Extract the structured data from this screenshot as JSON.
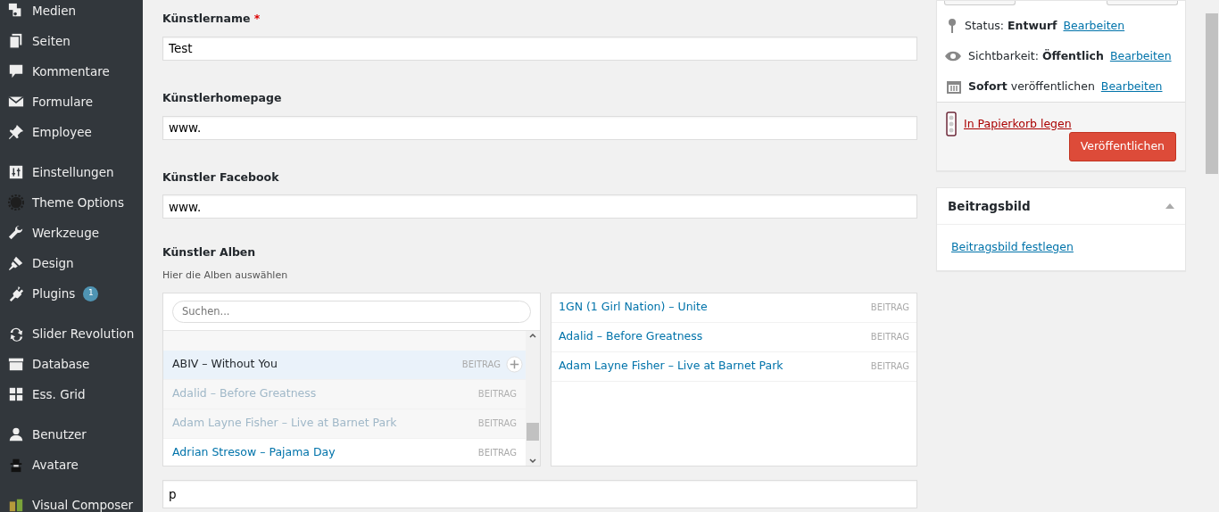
{
  "sidebar": {
    "groups": [
      [
        {
          "label": "Medien"
        },
        {
          "label": "Seiten"
        },
        {
          "label": "Kommentare"
        },
        {
          "label": "Formulare"
        },
        {
          "label": "Employee"
        }
      ],
      [
        {
          "label": "Einstellungen"
        },
        {
          "label": "Theme Options"
        },
        {
          "label": "Werkzeuge"
        },
        {
          "label": "Design"
        },
        {
          "label": "Plugins",
          "badge": "1"
        }
      ],
      [
        {
          "label": "Slider Revolution"
        },
        {
          "label": "Database"
        },
        {
          "label": "Ess. Grid"
        }
      ],
      [
        {
          "label": "Benutzer"
        },
        {
          "label": "Avatare"
        }
      ],
      [
        {
          "label": "Visual Composer"
        }
      ]
    ]
  },
  "fields": [
    {
      "label": "Künstlername",
      "required_mark": "*",
      "value": "Test"
    },
    {
      "label": "Künstlerhomepage",
      "value": "www."
    },
    {
      "label": "Künstler Facebook",
      "value": "www."
    }
  ],
  "relationship": {
    "label": "Künstler Alben",
    "hint": "Hier die Alben auswählen",
    "search": {
      "placeholder": "Suchen..."
    },
    "choices": [
      {
        "title": "ABIV – Without You",
        "type": "BEITRAG",
        "selected": true,
        "disabled": false
      },
      {
        "title": "Adalid – Before Greatness",
        "type": "BEITRAG",
        "selected": false,
        "disabled": true
      },
      {
        "title": "Adam Layne Fisher – Live at Barnet Park",
        "type": "BEITRAG",
        "selected": false,
        "disabled": true
      },
      {
        "title": "Adrian Stresow – Pajama Day",
        "type": "BEITRAG",
        "selected": false,
        "disabled": false
      }
    ],
    "values": [
      {
        "title": "1GN (1 Girl Nation) – Unite",
        "type": "BEITRAG"
      },
      {
        "title": "Adalid – Before Greatness",
        "type": "BEITRAG"
      },
      {
        "title": "Adam Layne Fisher – Live at Barnet Park",
        "type": "BEITRAG"
      }
    ]
  },
  "next_field": {
    "value": "p"
  },
  "publish": {
    "rows": [
      {
        "text": "Status: **Entwurf**",
        "link": "Bearbeiten"
      },
      {
        "text": "Sichtbarkeit: **Öffentlich**",
        "link": "Bearbeiten"
      },
      {
        "text": "**Sofort** veröffentlichen",
        "link": "Bearbeiten"
      }
    ],
    "trash": "In Papierkorb legen",
    "button": "Veröffentlichen"
  },
  "featured_image": {
    "title": "Beitragsbild",
    "link": "Beitragsbild festlegen"
  }
}
